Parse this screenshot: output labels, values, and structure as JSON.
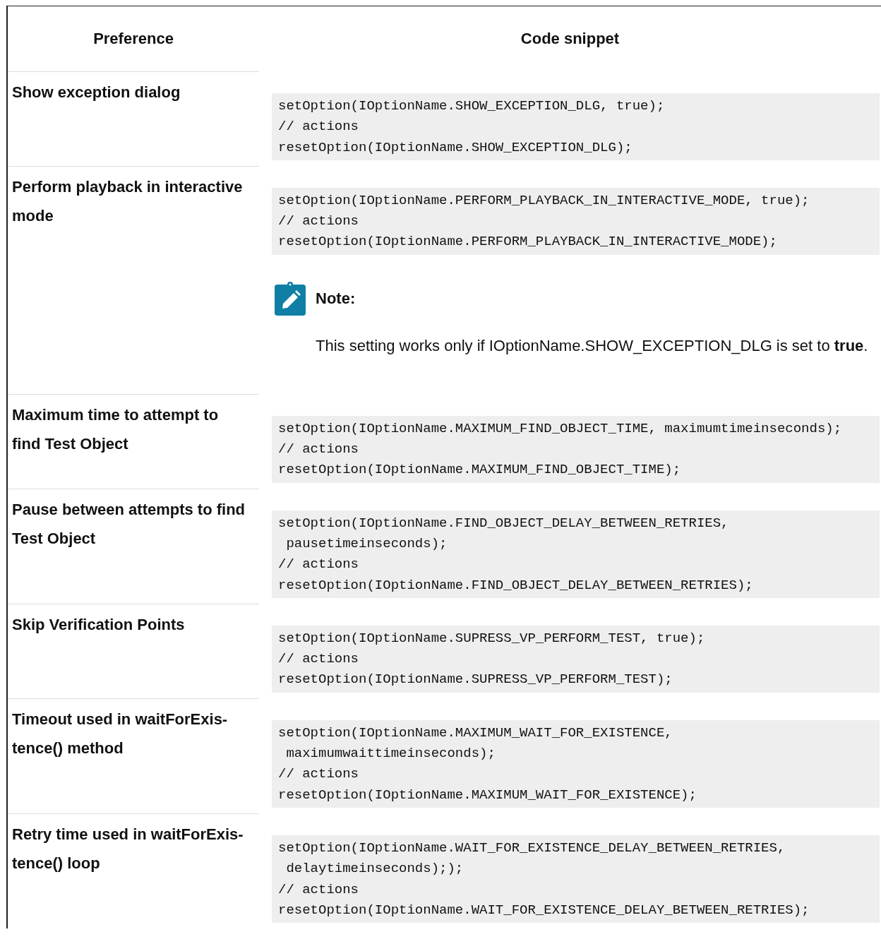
{
  "table": {
    "columns": [
      "Preference",
      "Code snippet"
    ],
    "rows": [
      {
        "preference_lines": [
          "Show exception dialog"
        ],
        "code_lines": [
          "setOption(IOptionName.SHOW_EXCEPTION_DLG, true);",
          "// actions",
          "resetOption(IOptionName.SHOW_EXCEPTION_DLG);"
        ]
      },
      {
        "preference_lines": [
          "Perform playback in interactive",
          "mode"
        ],
        "code_lines": [
          "setOption(IOptionName.PERFORM_PLAYBACK_IN_INTERACTIVE_MODE, true);",
          "// actions",
          "resetOption(IOptionName.PERFORM_PLAYBACK_IN_INTERACTIVE_MODE);"
        ],
        "note": {
          "title": "Note:",
          "text": "This setting works only if IOptionName.SHOW_EXCEPTION_DLG is set to **true**."
        }
      },
      {
        "preference_lines": [
          "Maximum time to attempt to",
          "find Test Object"
        ],
        "code_lines": [
          "setOption(IOptionName.MAXIMUM_FIND_OBJECT_TIME, maximumtimeinseconds);",
          "// actions",
          "resetOption(IOptionName.MAXIMUM_FIND_OBJECT_TIME);"
        ]
      },
      {
        "preference_lines": [
          "Pause between attempts to find",
          "Test Object"
        ],
        "code_lines": [
          "setOption(IOptionName.FIND_OBJECT_DELAY_BETWEEN_RETRIES,",
          " pausetimeinseconds);",
          "// actions",
          "resetOption(IOptionName.FIND_OBJECT_DELAY_BETWEEN_RETRIES);"
        ]
      },
      {
        "preference_lines": [
          "Skip Verification Points"
        ],
        "code_lines": [
          "setOption(IOptionName.SUPRESS_VP_PERFORM_TEST, true);",
          "// actions",
          "resetOption(IOptionName.SUPRESS_VP_PERFORM_TEST);"
        ]
      },
      {
        "preference_lines": [
          "Timeout used in waitForExis-",
          "tence() method"
        ],
        "code_lines": [
          "setOption(IOptionName.MAXIMUM_WAIT_FOR_EXISTENCE,",
          " maximumwaittimeinseconds);",
          "// actions",
          "resetOption(IOptionName.MAXIMUM_WAIT_FOR_EXISTENCE);"
        ]
      },
      {
        "preference_lines": [
          "Retry time used in waitForExis-",
          "tence() loop"
        ],
        "code_lines": [
          "setOption(IOptionName.WAIT_FOR_EXISTENCE_DELAY_BETWEEN_RETRIES,",
          " delaytimeinseconds););",
          "// actions",
          "resetOption(IOptionName.WAIT_FOR_EXISTENCE_DELAY_BETWEEN_RETRIES);"
        ]
      }
    ]
  }
}
